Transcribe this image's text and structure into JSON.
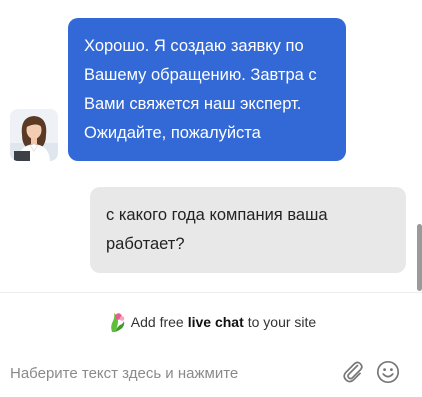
{
  "messages": [
    {
      "sender": "agent",
      "text": "Хорошо. Я создаю заявку по Вашему обращению. Завтра с Вами свяжется наш эксперт. Ожидайте, пожалуйста"
    },
    {
      "sender": "user",
      "text": "с какого года компания ваша работает?"
    }
  ],
  "promo": {
    "prefix": "Add free",
    "highlight": "live chat",
    "suffix": "to your site"
  },
  "composer": {
    "placeholder": "Наберите текст здесь и нажмите"
  },
  "icons": {
    "attach": "paperclip-icon",
    "emoji": "smiley-icon",
    "brand": "chat-brand-icon"
  },
  "colors": {
    "agent_bubble": "#3369d6",
    "user_bubble": "#e8e8e8"
  }
}
